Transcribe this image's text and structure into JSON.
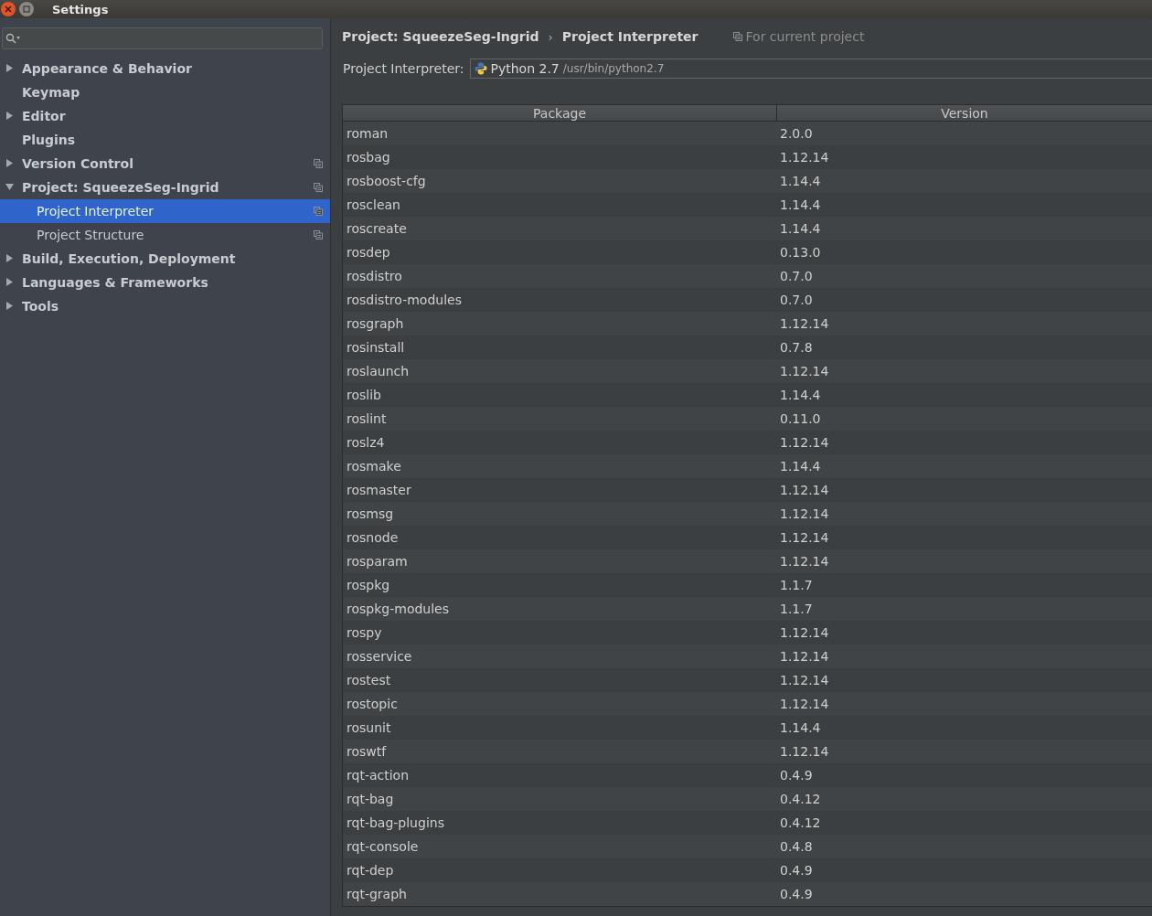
{
  "window": {
    "title": "Settings"
  },
  "sidebar": {
    "items": [
      {
        "label": "Appearance & Behavior",
        "expanded": false,
        "project_scoped": false,
        "selected": false
      },
      {
        "label": "Keymap",
        "project_scoped": false,
        "selected": false
      },
      {
        "label": "Editor",
        "expanded": false,
        "project_scoped": false,
        "selected": false
      },
      {
        "label": "Plugins",
        "project_scoped": false,
        "selected": false
      },
      {
        "label": "Version Control",
        "expanded": false,
        "project_scoped": true,
        "selected": false
      },
      {
        "label": "Project: SqueezeSeg-Ingrid",
        "expanded": true,
        "project_scoped": true,
        "selected": false,
        "children": [
          {
            "label": "Project Interpreter",
            "project_scoped": true,
            "selected": true
          },
          {
            "label": "Project Structure",
            "project_scoped": true,
            "selected": false
          }
        ]
      },
      {
        "label": "Build, Execution, Deployment",
        "expanded": false,
        "project_scoped": false,
        "selected": false
      },
      {
        "label": "Languages & Frameworks",
        "expanded": false,
        "project_scoped": false,
        "selected": false
      },
      {
        "label": "Tools",
        "expanded": false,
        "project_scoped": false,
        "selected": false
      }
    ]
  },
  "breadcrumb": {
    "items": [
      "Project: SqueezeSeg-Ingrid",
      "Project Interpreter"
    ],
    "separator": "›",
    "scope_note": "For current project"
  },
  "interpreter": {
    "label": "Project Interpreter:",
    "name": "Python 2.7",
    "path": "/usr/bin/python2.7"
  },
  "table": {
    "columns": [
      "Package",
      "Version"
    ],
    "rows": [
      [
        "roman",
        "2.0.0"
      ],
      [
        "rosbag",
        "1.12.14"
      ],
      [
        "rosboost-cfg",
        "1.14.4"
      ],
      [
        "rosclean",
        "1.14.4"
      ],
      [
        "roscreate",
        "1.14.4"
      ],
      [
        "rosdep",
        "0.13.0"
      ],
      [
        "rosdistro",
        "0.7.0"
      ],
      [
        "rosdistro-modules",
        "0.7.0"
      ],
      [
        "rosgraph",
        "1.12.14"
      ],
      [
        "rosinstall",
        "0.7.8"
      ],
      [
        "roslaunch",
        "1.12.14"
      ],
      [
        "roslib",
        "1.14.4"
      ],
      [
        "roslint",
        "0.11.0"
      ],
      [
        "roslz4",
        "1.12.14"
      ],
      [
        "rosmake",
        "1.14.4"
      ],
      [
        "rosmaster",
        "1.12.14"
      ],
      [
        "rosmsg",
        "1.12.14"
      ],
      [
        "rosnode",
        "1.12.14"
      ],
      [
        "rosparam",
        "1.12.14"
      ],
      [
        "rospkg",
        "1.1.7"
      ],
      [
        "rospkg-modules",
        "1.1.7"
      ],
      [
        "rospy",
        "1.12.14"
      ],
      [
        "rosservice",
        "1.12.14"
      ],
      [
        "rostest",
        "1.12.14"
      ],
      [
        "rostopic",
        "1.12.14"
      ],
      [
        "rosunit",
        "1.14.4"
      ],
      [
        "roswtf",
        "1.12.14"
      ],
      [
        "rqt-action",
        "0.4.9"
      ],
      [
        "rqt-bag",
        "0.4.12"
      ],
      [
        "rqt-bag-plugins",
        "0.4.12"
      ],
      [
        "rqt-console",
        "0.4.8"
      ],
      [
        "rqt-dep",
        "0.4.9"
      ],
      [
        "rqt-graph",
        "0.4.9"
      ]
    ]
  }
}
